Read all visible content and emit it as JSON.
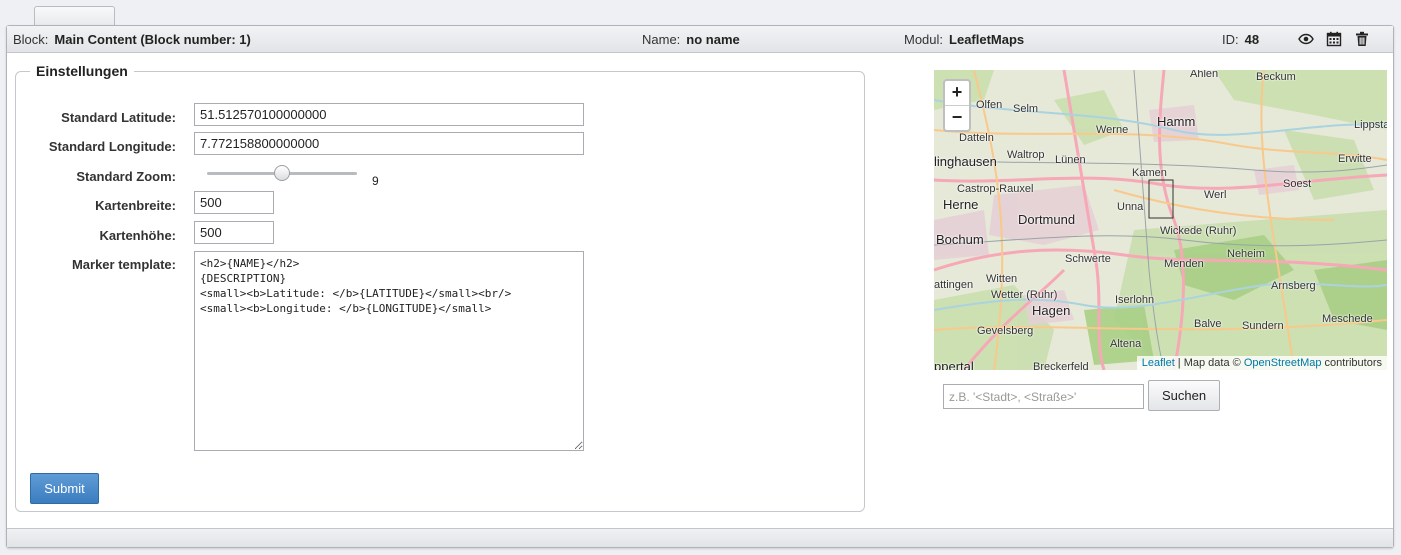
{
  "header": {
    "block_label": "Block:",
    "block_value": "Main Content (Block number: 1)",
    "name_label": "Name:",
    "name_value": "no name",
    "modul_label": "Modul:",
    "modul_value": "LeafletMaps",
    "id_label": "ID:",
    "id_value": "48",
    "icons": [
      "eye-icon",
      "calendar-icon",
      "trash-icon"
    ]
  },
  "settings": {
    "legend": "Einstellungen",
    "latitude_label": "Standard Latitude:",
    "latitude_value": "51.512570100000000",
    "longitude_label": "Standard Longitude:",
    "longitude_value": "7.772158800000000",
    "zoom_label": "Standard Zoom:",
    "zoom_value": "9",
    "width_label": "Kartenbreite:",
    "width_value": "500",
    "height_label": "Kartenhöhe:",
    "height_value": "500",
    "marker_label": "Marker template:",
    "marker_value": "<h2>{NAME}</h2>\n{DESCRIPTION}\n<small><b>Latitude: </b>{LATITUDE}</small><br/>\n<small><b>Longitude: </b>{LONGITUDE}</small>",
    "submit_label": "Submit"
  },
  "map": {
    "zoom_in": "+",
    "zoom_out": "−",
    "attribution_leaflet": "Leaflet",
    "attribution_sep": " | Map data © ",
    "attribution_osm": "OpenStreetMap",
    "attribution_suffix": " contributors",
    "places": [
      {
        "id": "ahlen",
        "text": "Ahlen"
      },
      {
        "id": "beckum",
        "text": "Beckum"
      },
      {
        "id": "olfen",
        "text": "Olfen"
      },
      {
        "id": "selm",
        "text": "Selm"
      },
      {
        "id": "hamm",
        "text": "Hamm"
      },
      {
        "id": "werne",
        "text": "Werne"
      },
      {
        "id": "lippstadt",
        "text": "Lippstad"
      },
      {
        "id": "datteln",
        "text": "Datteln"
      },
      {
        "id": "recklinghausen",
        "text": "linghausen"
      },
      {
        "id": "waltrop",
        "text": "Waltrop"
      },
      {
        "id": "luenen",
        "text": "Lünen"
      },
      {
        "id": "erwitte",
        "text": "Erwitte"
      },
      {
        "id": "kamen",
        "text": "Kamen"
      },
      {
        "id": "castrop",
        "text": "Castrop-Rauxel"
      },
      {
        "id": "soest",
        "text": "Soest"
      },
      {
        "id": "werl",
        "text": "Werl"
      },
      {
        "id": "herne",
        "text": "Herne"
      },
      {
        "id": "unna",
        "text": "Unna"
      },
      {
        "id": "dortmund",
        "text": "Dortmund"
      },
      {
        "id": "wickede",
        "text": "Wickede (Ruhr)"
      },
      {
        "id": "bochum",
        "text": "Bochum"
      },
      {
        "id": "neheim",
        "text": "Neheim"
      },
      {
        "id": "schwerte",
        "text": "Schwerte"
      },
      {
        "id": "menden",
        "text": "Menden"
      },
      {
        "id": "hattingen",
        "text": "attingen"
      },
      {
        "id": "witten",
        "text": "Witten"
      },
      {
        "id": "arnsberg",
        "text": "Arnsberg"
      },
      {
        "id": "wetter",
        "text": "Wetter (Ruhr)"
      },
      {
        "id": "iserlohn",
        "text": "Iserlohn"
      },
      {
        "id": "hagen",
        "text": "Hagen"
      },
      {
        "id": "meschede",
        "text": "Meschede"
      },
      {
        "id": "balve",
        "text": "Balve"
      },
      {
        "id": "sundern",
        "text": "Sundern"
      },
      {
        "id": "gevelsberg",
        "text": "Gevelsberg"
      },
      {
        "id": "altena",
        "text": "Altena"
      },
      {
        "id": "breckerfeld",
        "text": "Breckerfeld"
      },
      {
        "id": "wuppertal",
        "text": "ppertal"
      }
    ]
  },
  "search": {
    "placeholder": "z.B. '<Stadt>, <Straße>'",
    "button_label": "Suchen"
  }
}
